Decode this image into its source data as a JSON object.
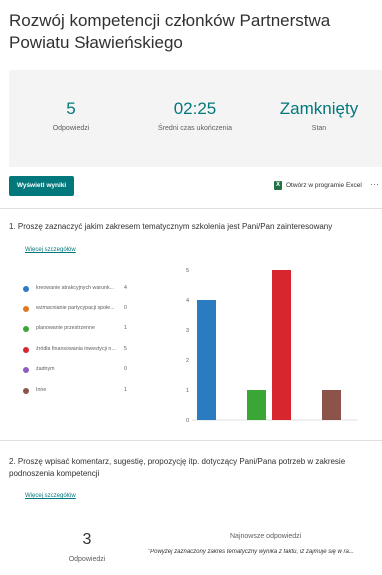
{
  "form": {
    "title": "Rozwój kompetencji członków Partnerstwa Powiatu Sławieńskiego"
  },
  "summary": {
    "responses_value": "5",
    "responses_label": "Odpowiedzi",
    "avg_time_value": "02:25",
    "avg_time_label": "Średni czas ukończenia",
    "status_value": "Zamknięty",
    "status_label": "Stan"
  },
  "toolbar": {
    "view_results_label": "Wyświetl wyniki",
    "excel_label": "Otwórz w programie Excel",
    "more_label": "···",
    "excel_icon": "excel-icon"
  },
  "questions": [
    {
      "text": "1. Proszę zaznaczyć jakim zakresem tematycznym szkolenia jest Pani/Pan zainteresowany",
      "more_details": "Więcej szczegółów"
    },
    {
      "text": "2. Proszę wpisać komentarz, sugestię, propozycję itp. dotyczący Pani/Pana potrzeb w zakresie podnoszenia kompetencji",
      "more_details": "Więcej szczegółów",
      "responses_count": "3",
      "responses_label": "Odpowiedzi",
      "latest_heading": "Najnowsze odpowiedzi",
      "latest_text": "\"Powyżej zaznaczony zakres tematyczny wynika z faktu, iż zajmuje się w ra..."
    }
  ],
  "chart_data": {
    "type": "bar",
    "categories": [
      "kreowanie atrakcyjnych warunk...",
      "wzmacnianie partycypacji społe...",
      "planowanie przestrzenne",
      "źródła finansowania inwestycji n...",
      "żadnym",
      "Inne"
    ],
    "values": [
      4,
      0,
      1,
      5,
      0,
      1
    ],
    "colors": [
      "#2b7bc0",
      "#e0781f",
      "#3aa635",
      "#d7262e",
      "#8e5cc2",
      "#8b5349"
    ],
    "ylim": [
      0,
      5
    ],
    "yticks": [
      "0",
      "1",
      "2",
      "3",
      "4",
      "5"
    ],
    "legend": "left",
    "grid": false
  }
}
